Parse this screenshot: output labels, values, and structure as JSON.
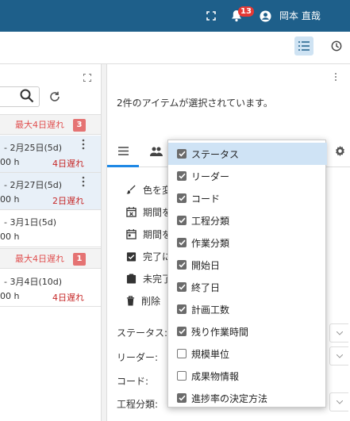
{
  "header": {
    "notification_count": "13",
    "user_name": "岡本 直哉"
  },
  "left": {
    "groups": [
      {
        "late_label": "最大4日遅れ",
        "count": "3"
      },
      {
        "late_label": "最大4日遅れ",
        "count": "1"
      }
    ],
    "tasks": [
      {
        "date": "- 2月25日(5d)",
        "hours": "00 h",
        "overdue": "4日遅れ"
      },
      {
        "date": "- 2月27日(5d)",
        "hours": "00 h",
        "overdue": "2日遅れ"
      },
      {
        "date": "- 3月1日(5d)",
        "hours": "00 h",
        "overdue": ""
      },
      {
        "date": "- 3月4日(10d)",
        "hours": "00 h",
        "overdue": "4日遅れ"
      }
    ]
  },
  "right": {
    "selected_message": "2件のアイテムが選択されています。",
    "actions": [
      "色を変",
      "期間を",
      "期間を",
      "完了に",
      "未完了",
      "削除"
    ],
    "fields": [
      "ステータス:",
      "リーダー:",
      "コード:",
      "工程分類:"
    ]
  },
  "dropdown": {
    "items": [
      {
        "label": "ステータス",
        "checked": true
      },
      {
        "label": "リーダー",
        "checked": true
      },
      {
        "label": "コード",
        "checked": true
      },
      {
        "label": "工程分類",
        "checked": true
      },
      {
        "label": "作業分類",
        "checked": true
      },
      {
        "label": "開始日",
        "checked": true
      },
      {
        "label": "終了日",
        "checked": true
      },
      {
        "label": "計画工数",
        "checked": true
      },
      {
        "label": "残り作業時間",
        "checked": true
      },
      {
        "label": "規模単位",
        "checked": false
      },
      {
        "label": "成果物情報",
        "checked": false
      },
      {
        "label": "進捗率の決定方法",
        "checked": true
      }
    ]
  }
}
